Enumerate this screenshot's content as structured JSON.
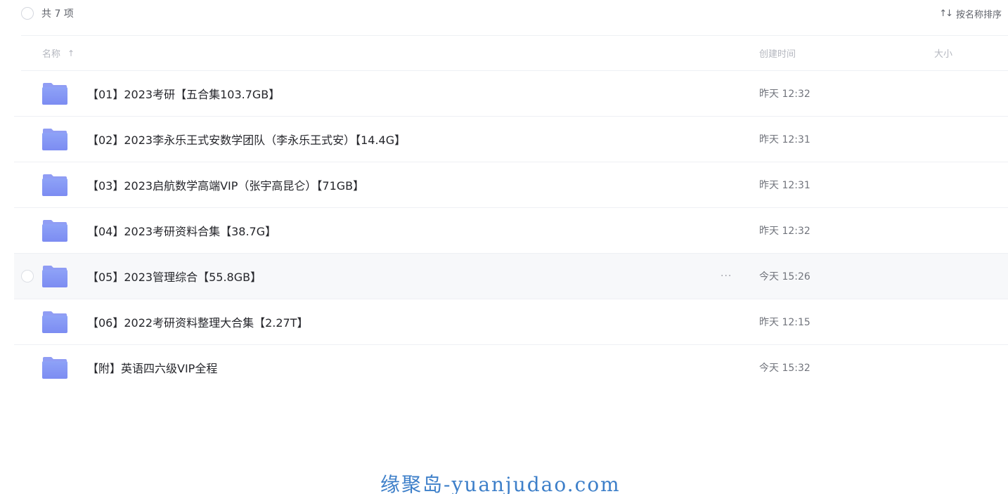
{
  "toolbar": {
    "total_label": "共 7 项",
    "sort_icon": "sort-arrows-icon",
    "sort_label": "按名称排序"
  },
  "columns": {
    "name": "名称",
    "name_sort_arrow": "↑",
    "created": "创建时间",
    "size": "大小"
  },
  "files": [
    {
      "name": "【01】2023考研【五合集103.7GB】",
      "created": "昨天 12:32",
      "type": "folder"
    },
    {
      "name": "【02】2023李永乐王式安数学团队（李永乐王式安）【14.4G】",
      "created": "昨天 12:31",
      "type": "folder"
    },
    {
      "name": "【03】2023启航数学高端VIP（张宇高昆仑）【71GB】",
      "created": "昨天 12:31",
      "type": "folder"
    },
    {
      "name": "【04】2023考研资料合集【38.7G】",
      "created": "昨天 12:32",
      "type": "folder"
    },
    {
      "name": "【05】2023管理综合【55.8GB】",
      "created": "今天 15:26",
      "type": "folder",
      "hovered": true,
      "more_label": "···"
    },
    {
      "name": "【06】2022考研资料整理大合集【2.27T】",
      "created": "昨天 12:15",
      "type": "folder"
    },
    {
      "name": "【附】英语四六级VIP全程",
      "created": "今天 15:32",
      "type": "folder"
    }
  ],
  "watermark": "缘聚岛-yuanjudao.com",
  "colors": {
    "folder_top": "#8ea2f7",
    "folder_bottom": "#7c8cf2",
    "hover_bg": "#f7f8fa",
    "watermark": "#3d7fc9"
  }
}
